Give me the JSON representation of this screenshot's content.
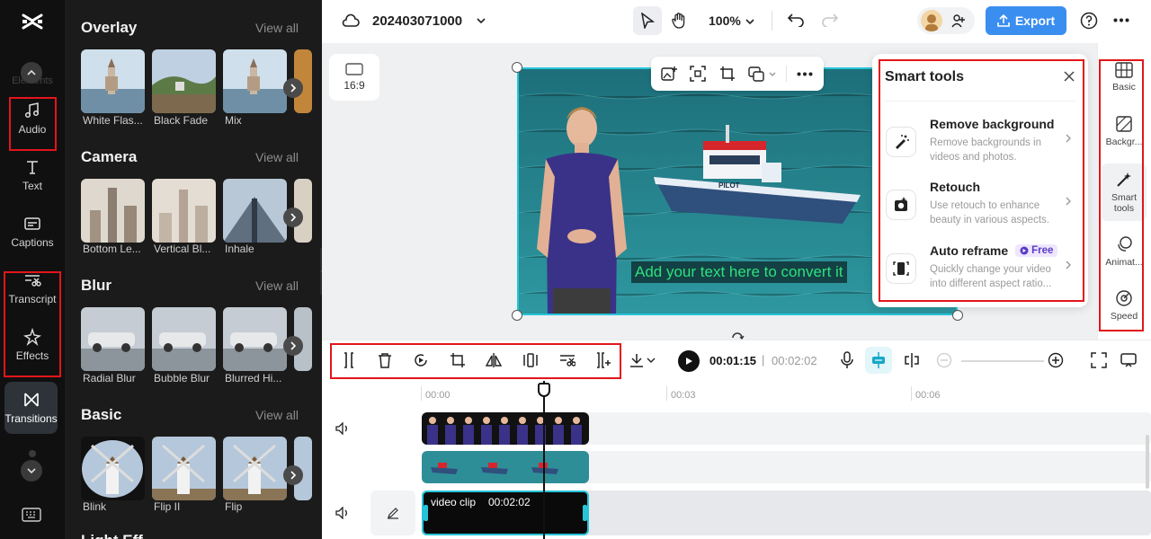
{
  "left_rail": {
    "faded_label": "Elements",
    "items": [
      {
        "label": "Audio",
        "icon": "music-note-icon"
      },
      {
        "label": "Text",
        "icon": "text-icon"
      },
      {
        "label": "Captions",
        "icon": "captions-icon"
      },
      {
        "label": "Transcript",
        "icon": "transcript-icon"
      },
      {
        "label": "Effects",
        "icon": "effects-star-icon"
      },
      {
        "label": "Transitions",
        "icon": "transitions-icon",
        "active": true
      }
    ]
  },
  "panel": {
    "view_all": "View all",
    "sections": [
      {
        "title": "Overlay",
        "items": [
          "White Flas...",
          "Black Fade",
          "Mix"
        ]
      },
      {
        "title": "Camera",
        "items": [
          "Bottom Le...",
          "Vertical Bl...",
          "Inhale"
        ]
      },
      {
        "title": "Blur",
        "items": [
          "Radial Blur",
          "Bubble Blur",
          "Blurred Hi..."
        ]
      },
      {
        "title": "Basic",
        "items": [
          "Blink",
          "Flip II",
          "Flip"
        ]
      }
    ],
    "partial_next_section": "Light Eff"
  },
  "topbar": {
    "project_name": "202403071000",
    "zoom": "100%",
    "export_label": "Export"
  },
  "workspace": {
    "ratio_label": "16:9",
    "caption_text": "Add your text here to convert it",
    "boat_text": "PILOT"
  },
  "smart_tools": {
    "title": "Smart tools",
    "items": [
      {
        "name": "Remove background",
        "desc": "Remove backgrounds in videos and photos."
      },
      {
        "name": "Retouch",
        "desc": "Use retouch to enhance beauty in various aspects."
      },
      {
        "name": "Auto reframe",
        "desc": "Quickly change your video into different aspect ratio...",
        "badge": "Free"
      }
    ]
  },
  "right_rail": {
    "items": [
      {
        "label": "Basic",
        "icon": "basic-icon"
      },
      {
        "label": "Backgr...",
        "icon": "background-icon"
      },
      {
        "label": "Smart tools",
        "icon": "magic-wand-icon",
        "active": true
      },
      {
        "label": "Animat...",
        "icon": "animation-icon"
      },
      {
        "label": "Speed",
        "icon": "speed-icon"
      }
    ]
  },
  "timeline": {
    "current_time": "00:01:15",
    "separator": "|",
    "total_time": "00:02:02",
    "ruler": [
      "00:00",
      "00:03",
      "00:06"
    ],
    "clip_label": "video clip",
    "clip_duration": "00:02:02"
  },
  "colors": {
    "accent": "#3a8ef0",
    "highlight_box": "#e3151a",
    "selection": "#26c4d9",
    "caption_text": "#2ee07d"
  }
}
